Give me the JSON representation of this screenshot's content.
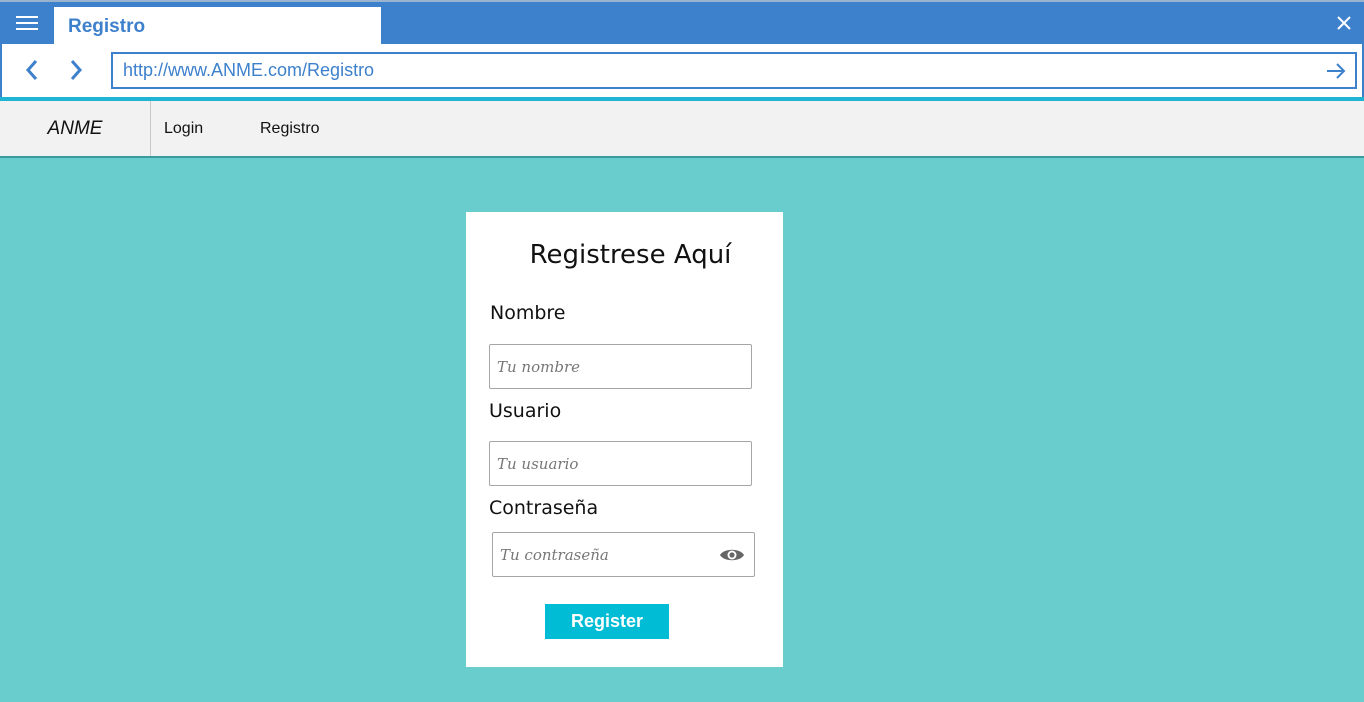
{
  "browser": {
    "tab_title": "Registro",
    "url": "http://www.ANME.com/Registro",
    "icons": {
      "menu": "hamburger-icon",
      "close": "close-icon",
      "back": "chevron-left-icon",
      "forward": "chevron-right-icon",
      "go": "arrow-right-icon"
    },
    "colors": {
      "chrome": "#3d80cc",
      "accent": "#1fb3d4"
    }
  },
  "navbar": {
    "brand": "ANME",
    "links": [
      "Login",
      "Registro"
    ]
  },
  "form": {
    "title": "Registrese Aquí",
    "fields": [
      {
        "label": "Nombre",
        "placeholder": "Tu nombre",
        "value": ""
      },
      {
        "label": "Usuario",
        "placeholder": "Tu usuario",
        "value": ""
      },
      {
        "label": "Contraseña",
        "placeholder": "Tu contraseña",
        "value": "",
        "icon": "eye-icon"
      }
    ],
    "submit_label": "Register"
  },
  "colors": {
    "page_background": "#68cdcc",
    "button": "#00bcd4"
  }
}
